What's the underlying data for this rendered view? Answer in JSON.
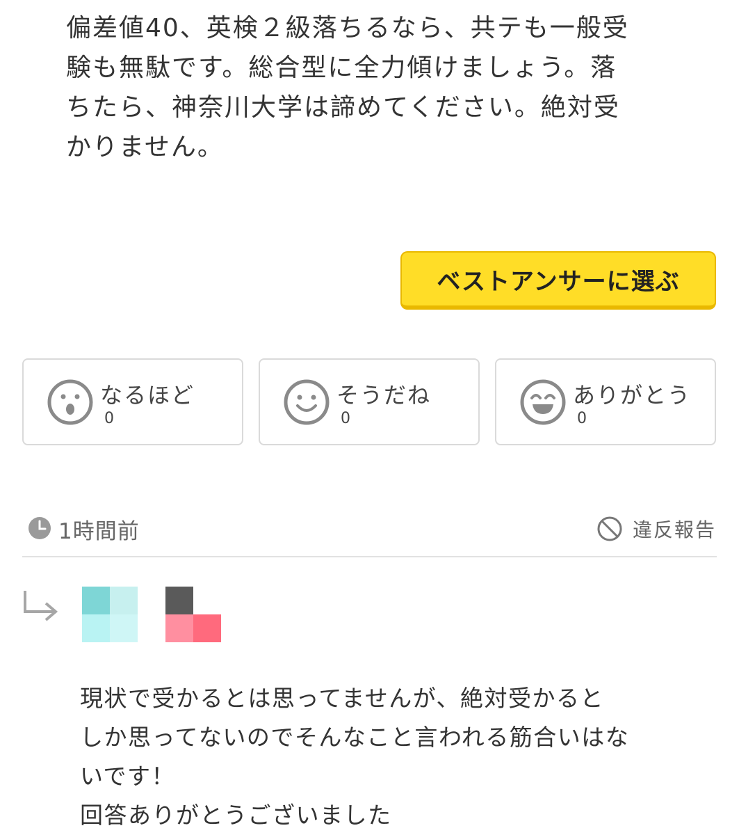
{
  "answer": {
    "lines": [
      "偏差値40、英検２級落ちるなら、共テも一般受",
      "験も無駄です。総合型に全力傾けましょう。落",
      "ちたら、神奈川大学は諦めてください。絶対受",
      "かりません。"
    ]
  },
  "best_answer_button": {
    "label": "ベストアンサーに選ぶ",
    "color": "#ffdd27"
  },
  "reactions": [
    {
      "label": "なるほど",
      "count": "0",
      "icon": "surprised-face-icon"
    },
    {
      "label": "そうだね",
      "count": "0",
      "icon": "smile-face-icon"
    },
    {
      "label": "ありがとう",
      "count": "0",
      "icon": "laughing-face-icon"
    }
  ],
  "meta": {
    "time": "1時間前",
    "time_icon": "clock-icon",
    "report_label": "違反報告",
    "report_icon": "ban-icon"
  },
  "reply": {
    "arrow_icon": "reply-arrow-icon",
    "lines": [
      "現状で受かるとは思ってませんが、絶対受かると",
      "しか思ってないのでそんなこと言われる筋合いはな",
      "いです！",
      "回答ありがとうございました"
    ]
  }
}
